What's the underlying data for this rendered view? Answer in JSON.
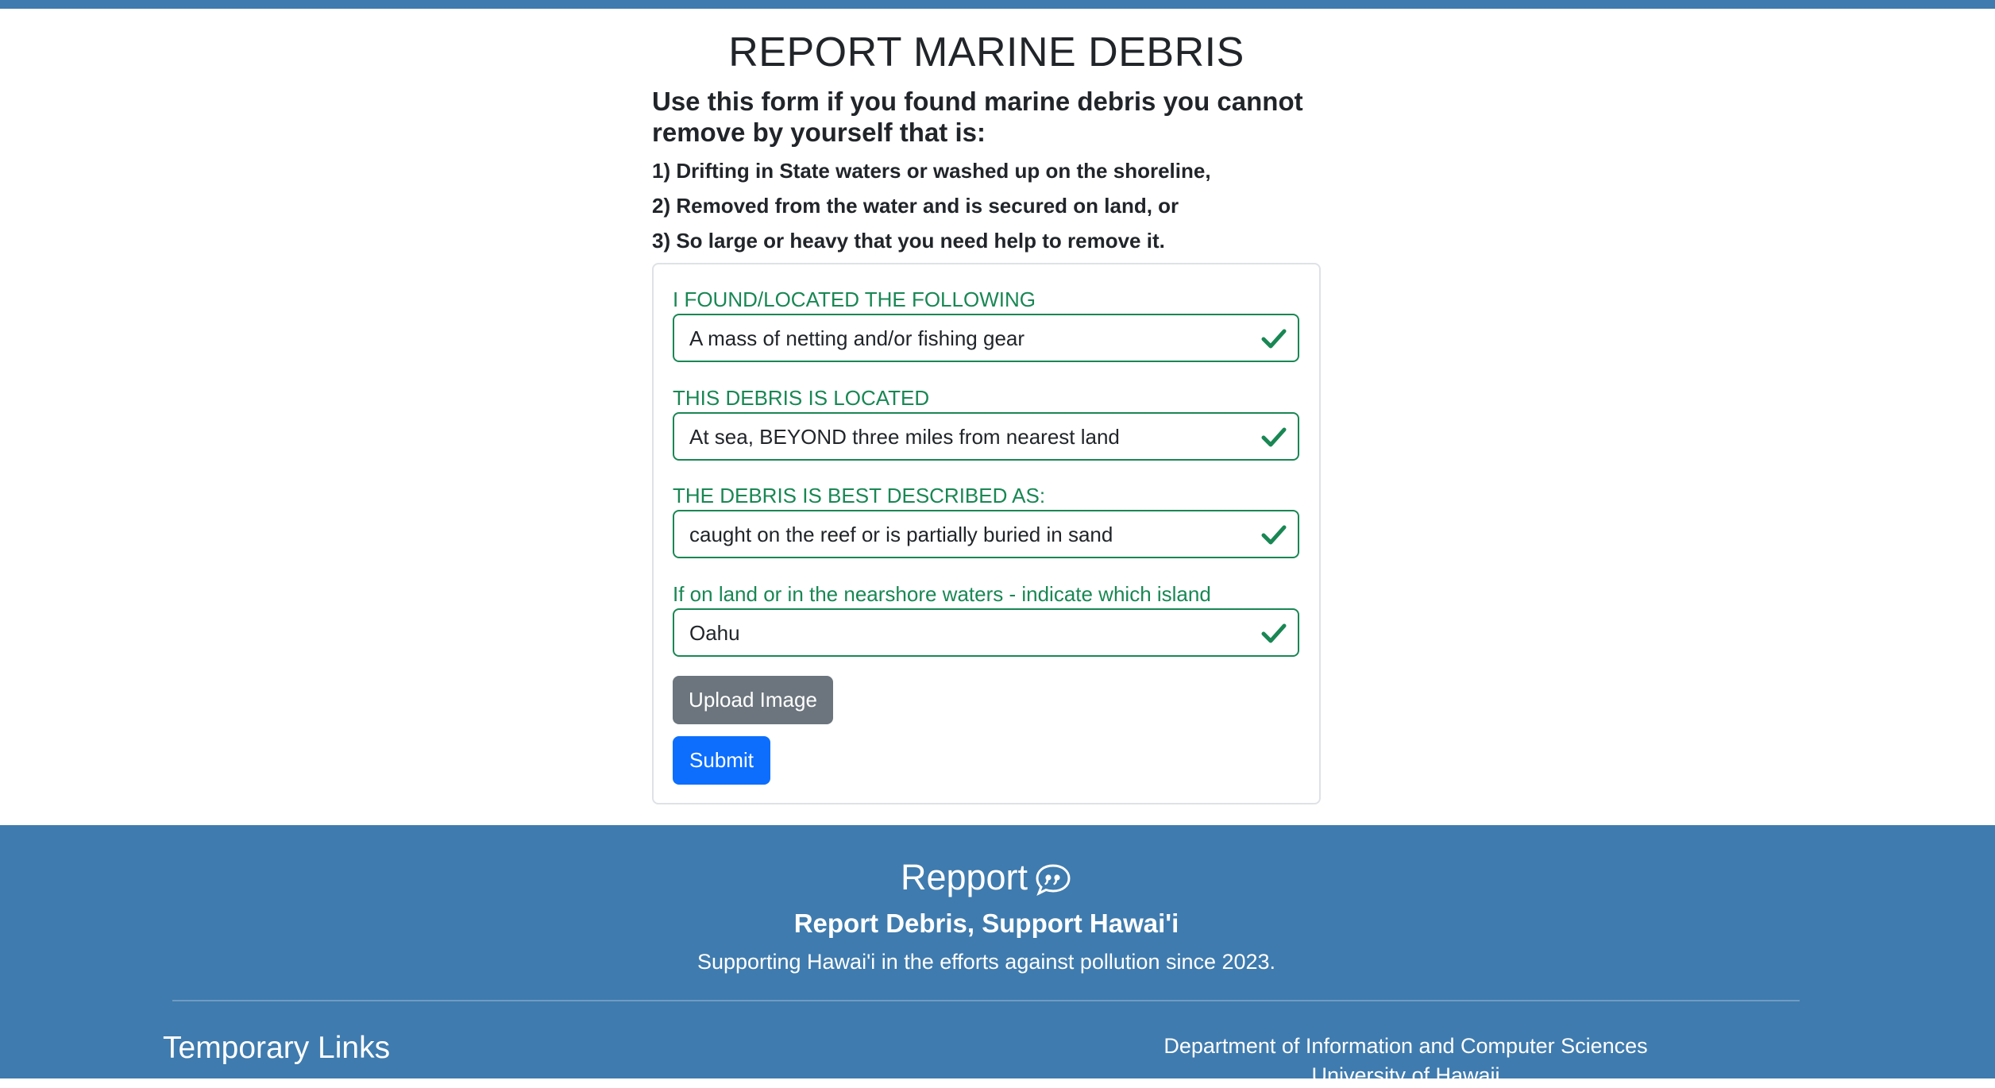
{
  "page": {
    "title": "REPORT MARINE DEBRIS",
    "intro_heading": "Use this form if you found marine debris you cannot remove by yourself that is:",
    "criteria": [
      "1) Drifting in State waters or washed up on the shoreline,",
      "2) Removed from the water and is secured on land, or",
      "3) So large or heavy that you need help to remove it."
    ]
  },
  "form": {
    "fields": [
      {
        "label": "I FOUND/LOCATED THE FOLLOWING",
        "value": "A mass of netting and/or fishing gear"
      },
      {
        "label": "THIS DEBRIS IS LOCATED",
        "value": "At sea, BEYOND three miles from nearest land"
      },
      {
        "label": "THE DEBRIS IS BEST DESCRIBED AS:",
        "value": "caught on the reef or is partially buried in sand"
      },
      {
        "label": "If on land or in the nearshore waters - indicate which island",
        "value": "Oahu"
      }
    ],
    "upload_label": "Upload Image",
    "submit_label": "Submit"
  },
  "footer": {
    "brand": "Repport",
    "brand_icon": "quote-chat-icon",
    "tagline": "Report Debris, Support Hawai'i",
    "mission": "Supporting Hawai'i in the efforts against pollution since 2023.",
    "links_heading": "Temporary Links",
    "department": "Department of Information and Computer Sciences",
    "university": "University of Hawaii"
  },
  "colors": {
    "header_footer": "#3f7bae",
    "valid": "#198754",
    "primary": "#0d6efd",
    "secondary": "#6c757d"
  }
}
